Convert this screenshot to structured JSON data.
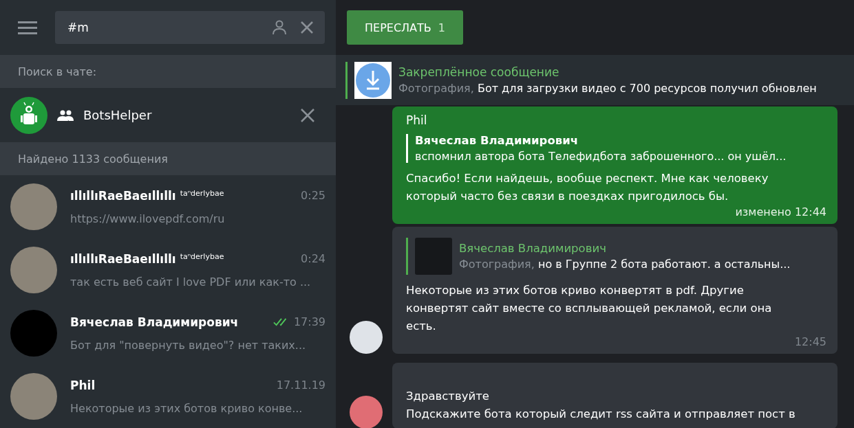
{
  "sidebar": {
    "search": {
      "value": "#m"
    },
    "scope_label": "Поиск в чате:",
    "scope_chat": {
      "name": "BotsHelper"
    },
    "results_label": "Найдено 1133 сообщения",
    "results": [
      {
        "kind": "photo",
        "name": "ıllıllıRaeBaeıllıllı",
        "tag": "taⁿderlybae",
        "time": "0:25",
        "read": false,
        "text": "https://www.ilovepdf.com/ru"
      },
      {
        "kind": "photo",
        "name": "ıllıllıRaeBaeıllıllı",
        "tag": "taⁿderlybae",
        "time": "0:24",
        "read": false,
        "text": "так есть веб сайт I love PDF или как-то ..."
      },
      {
        "kind": "blank",
        "name": "Вячеслав Владимирович",
        "time": "17:39",
        "read": true,
        "text": "Бот для \"повернуть видео\"? нет таких..."
      },
      {
        "kind": "photo",
        "name": "Phil",
        "time": "17.11.19",
        "read": false,
        "text": "Некоторые из этих ботов криво конве..."
      }
    ]
  },
  "forward_button": {
    "label": "ПЕРЕСЛАТЬ",
    "count": "1"
  },
  "pinned": {
    "title": "Закреплённое сообщение",
    "media": "Фотография,",
    "text": "Бот для загрузки видео с 700 ресурсов получил обновлен"
  },
  "messages": [
    {
      "kind": "outgoing",
      "sender": "Phil",
      "reply": {
        "author": "Вячеслав Владимирович",
        "text": "вспомнил автора бота Телефидбота заброшенного... он ушёл..."
      },
      "lines": [
        "Спасибо! Если найдешь, вообще респект. Мне как человеку",
        "который часто без связи в поездках пригодилось бы."
      ],
      "time": "изменено 12:44"
    },
    {
      "kind": "incoming",
      "reply": {
        "author": "Вячеслав Владимирович",
        "media": "Фотография,",
        "text": "но в Группе 2 бота работают. а остальны..."
      },
      "lines": [
        "Некоторые из этих ботов криво конвертят в pdf. Другие",
        "конвертят сайт вместе со всплывающей рекламой, если она",
        "есть."
      ],
      "time": "12:45"
    },
    {
      "kind": "incoming",
      "lines": [
        "Здравствуйте",
        "Подскажите бота который следит rss сайта и отправляет пост в"
      ]
    }
  ]
}
